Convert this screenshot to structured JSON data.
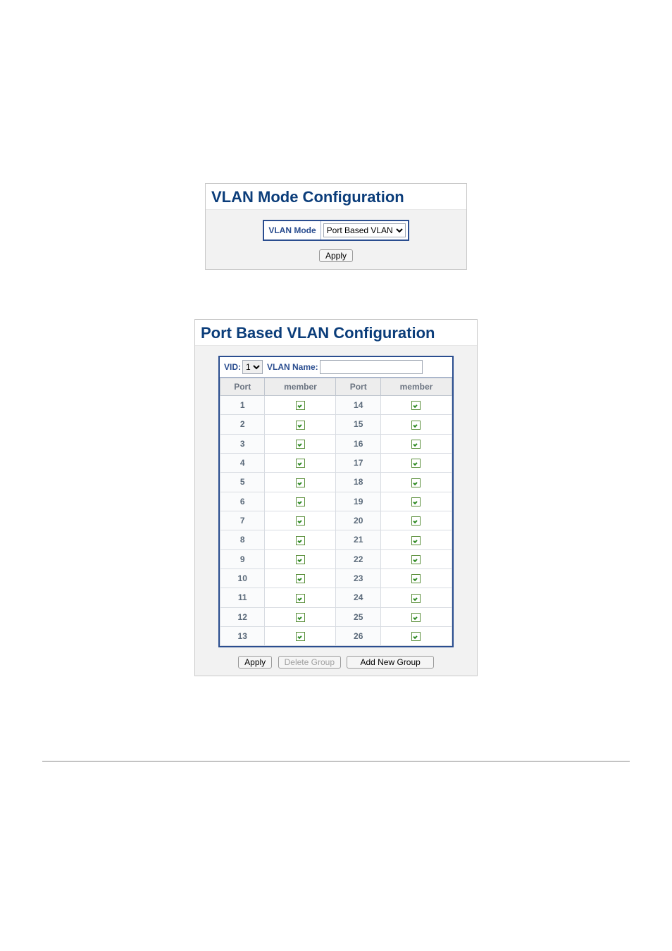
{
  "panel1": {
    "title": "VLAN Mode Configuration",
    "mode_label": "VLAN Mode",
    "mode_value": "Port Based VLAN",
    "apply_label": "Apply"
  },
  "panel2": {
    "title": "Port Based VLAN Configuration",
    "vid_label": "VID:",
    "vid_value": "1",
    "vlan_name_label": "VLAN Name:",
    "vlan_name_value": "",
    "headers": {
      "port": "Port",
      "member": "member"
    },
    "rows": [
      {
        "left_port": "1",
        "left_checked": true,
        "right_port": "14",
        "right_checked": true
      },
      {
        "left_port": "2",
        "left_checked": true,
        "right_port": "15",
        "right_checked": true
      },
      {
        "left_port": "3",
        "left_checked": true,
        "right_port": "16",
        "right_checked": true
      },
      {
        "left_port": "4",
        "left_checked": true,
        "right_port": "17",
        "right_checked": true
      },
      {
        "left_port": "5",
        "left_checked": true,
        "right_port": "18",
        "right_checked": true
      },
      {
        "left_port": "6",
        "left_checked": true,
        "right_port": "19",
        "right_checked": true
      },
      {
        "left_port": "7",
        "left_checked": true,
        "right_port": "20",
        "right_checked": true
      },
      {
        "left_port": "8",
        "left_checked": true,
        "right_port": "21",
        "right_checked": true
      },
      {
        "left_port": "9",
        "left_checked": true,
        "right_port": "22",
        "right_checked": true
      },
      {
        "left_port": "10",
        "left_checked": true,
        "right_port": "23",
        "right_checked": true
      },
      {
        "left_port": "11",
        "left_checked": true,
        "right_port": "24",
        "right_checked": true
      },
      {
        "left_port": "12",
        "left_checked": true,
        "right_port": "25",
        "right_checked": true
      },
      {
        "left_port": "13",
        "left_checked": true,
        "right_port": "26",
        "right_checked": true
      }
    ],
    "apply_label": "Apply",
    "delete_label": "Delete Group",
    "add_label": "Add New Group"
  }
}
